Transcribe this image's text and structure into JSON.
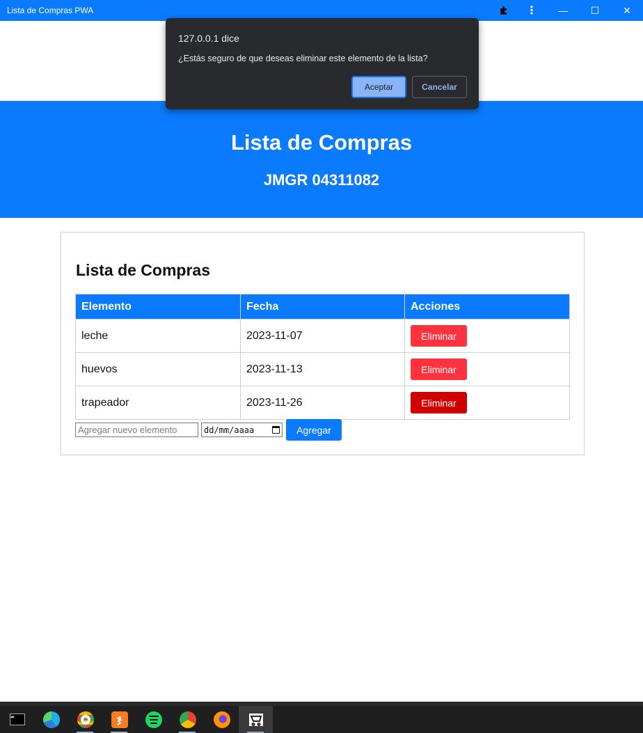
{
  "window": {
    "title": "Lista de Compras PWA",
    "controls": {
      "minimize": "—",
      "maximize": "☐",
      "close": "✕"
    }
  },
  "header": {
    "title": "Lista de Compras",
    "subtitle": "JMGR 04311082"
  },
  "list": {
    "heading": "Lista de Compras",
    "columns": [
      "Elemento",
      "Fecha",
      "Acciones"
    ],
    "rows": [
      {
        "item": "leche",
        "date": "2023-11-07",
        "action": "Eliminar"
      },
      {
        "item": "huevos",
        "date": "2023-11-13",
        "action": "Eliminar"
      },
      {
        "item": "trapeador",
        "date": "2023-11-26",
        "action": "Eliminar"
      }
    ],
    "new_item_placeholder": "Agregar nuevo elemento",
    "date_placeholder": "dd/mm/aaaa",
    "add_label": "Agregar"
  },
  "dialog": {
    "origin": "127.0.0.1 dice",
    "message": "¿Estás seguro de que deseas eliminar este elemento de la lista?",
    "ok_label": "Aceptar",
    "cancel_label": "Cancelar"
  },
  "colors": {
    "primary": "#0a7bff",
    "danger": "#ff3340",
    "danger_active": "#d00000",
    "dialog_bg": "#292a2d"
  },
  "taskbar": {
    "apps": [
      "terminal-icon",
      "edge-icon",
      "chrome-profile-icon",
      "xampp-icon",
      "spotify-icon",
      "chrome-profile-icon",
      "firefox-icon",
      "shopping-cart-app-icon"
    ]
  }
}
